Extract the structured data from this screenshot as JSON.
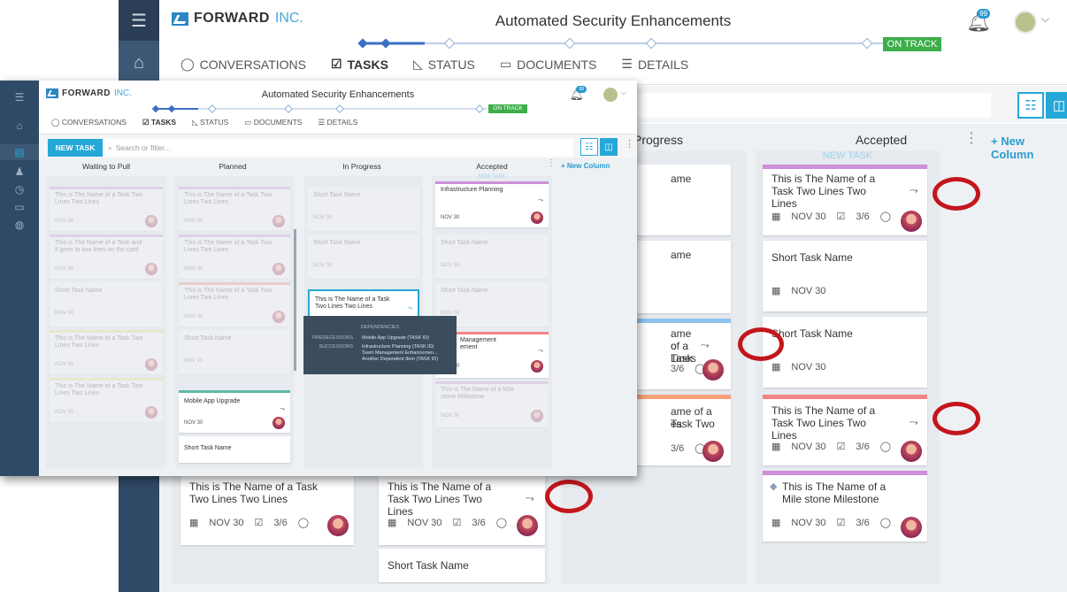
{
  "app": {
    "logo_main": "FORWARD",
    "logo_suffix": "INC.",
    "title": "Automated Security Enhancements",
    "status_badge": "ON TRACK",
    "notification_count": "99"
  },
  "tabs": [
    {
      "label": "CONVERSATIONS",
      "icon": "chat-bubble-icon"
    },
    {
      "label": "TASKS",
      "icon": "checkbox-icon",
      "active": true
    },
    {
      "label": "STATUS",
      "icon": "chart-icon"
    },
    {
      "label": "DOCUMENTS",
      "icon": "folder-icon"
    },
    {
      "label": "DETAILS",
      "icon": "list-icon"
    }
  ],
  "toolbar": {
    "new_task": "NEW TASK",
    "search_placeholder": "Search or filter..."
  },
  "columns": [
    "Waiting to Pull",
    "Planned",
    "In Progress",
    "Accepted"
  ],
  "new_column": "+ New Column",
  "new_task_label": "NEW TASK",
  "card_texts": {
    "long_name": "This is The Name of a Task Two Lines Two Lines",
    "long_name_alt": "This is The Name of a Task and it goes to two lines on the card",
    "short_name": "Short Task Name",
    "milestone": "This is The Name of a Mile stone Milestone",
    "date": "NOV 30",
    "checklist": "3/6",
    "infra": "Infrastructure Planning",
    "mobile": "Mobile App Upgrade"
  },
  "big_partial": {
    "col_title_inprogress_partial": "Progress",
    "frag_name": "ame",
    "frag_task": "ame of a Task",
    "frag_lines": "o Lines",
    "frag_task_two": "ame of a Task Two",
    "frag_es": "es",
    "frag_mgmt1": "Management",
    "frag_mgmt2": "ement"
  },
  "tooltip": {
    "header": "DEPENDENCIES",
    "predecessors_label": "PREDECESSORS",
    "predecessors": "Mobile App Upgrade (TASK ID)",
    "successors_label": "SUCCESSORS",
    "successors": [
      "Infrastructure Planning (TASK ID)",
      "Team Management Enhancemen...",
      "Another Dependent Item (TASK ID)"
    ]
  },
  "colors": {
    "nav": "#2f4a66",
    "accent": "#25a8d8",
    "on_track": "#3dae4a",
    "highlight_ring": "#c3161c"
  }
}
